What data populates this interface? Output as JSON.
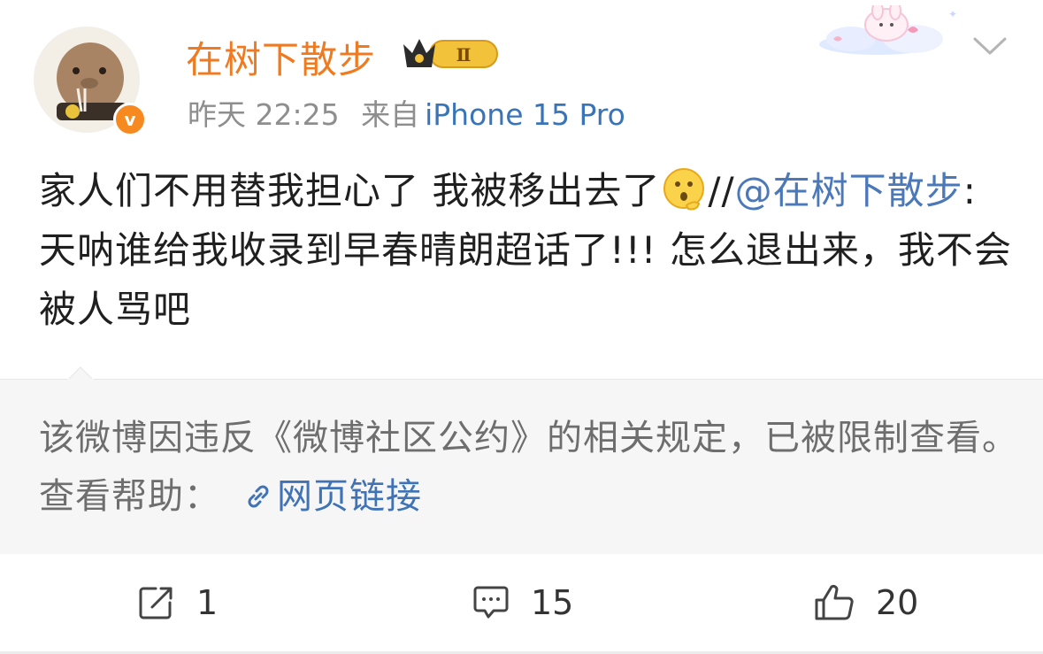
{
  "post": {
    "author": {
      "name": "在树下散步",
      "badge_level": "Ⅱ"
    },
    "meta": {
      "date": "昨天",
      "time": "22:25",
      "source_prefix": "来自",
      "source": "iPhone 15 Pro"
    },
    "content": {
      "text1": "家人们不用替我担心了 我被移出去了",
      "slashes": "//",
      "mention": "@在树下散步",
      "text2": ":天呐谁给我收录到早春晴朗超话了!!! 怎么退出来，我不会被人骂吧"
    }
  },
  "restriction": {
    "message": "该微博因违反《微博社区公约》的相关规定，已被限制查看。查看帮助：",
    "link_label": "网页链接"
  },
  "actions": {
    "reposts": "1",
    "comments": "15",
    "likes": "20"
  },
  "colors": {
    "username": "#f07a20",
    "link": "#3f73b6",
    "verified": "#f6891f",
    "restrict_bg": "#f6f6f6"
  },
  "icons": [
    "verified-icon",
    "crown-badge-icon",
    "chevron-down-icon",
    "emoji-icon",
    "link-icon",
    "repost-icon",
    "comment-icon",
    "like-icon"
  ]
}
